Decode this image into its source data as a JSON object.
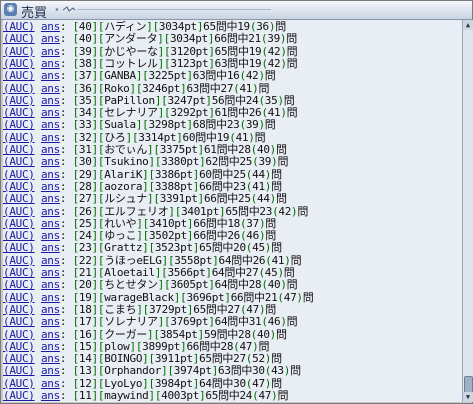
{
  "window": {
    "title": "売買"
  },
  "prefix": "(AUC)",
  "ans": "ans",
  "colon": ":",
  "rows": [
    {
      "rank": "40",
      "name": "ハディン",
      "pts": "3034pt",
      "pct": "65",
      "word": "問中",
      "a": "19",
      "b": "36",
      "tail": "問"
    },
    {
      "rank": "40",
      "name": "アンダータ",
      "pts": "3034pt",
      "pct": "66",
      "word": "問中",
      "a": "21",
      "b": "39",
      "tail": "問"
    },
    {
      "rank": "39",
      "name": "かじやーな",
      "pts": "3120pt",
      "pct": "65",
      "word": "問中",
      "a": "19",
      "b": "42",
      "tail": "問"
    },
    {
      "rank": "38",
      "name": "コットレル",
      "pts": "3123pt",
      "pct": "63",
      "word": "問中",
      "a": "19",
      "b": "42",
      "tail": "問"
    },
    {
      "rank": "37",
      "name": "GANBA",
      "pts": "3225pt",
      "pct": "63",
      "word": "問中",
      "a": "16",
      "b": "42",
      "tail": "問"
    },
    {
      "rank": "36",
      "name": "Roko",
      "pts": "3246pt",
      "pct": "63",
      "word": "問中",
      "a": "27",
      "b": "41",
      "tail": "問"
    },
    {
      "rank": "35",
      "name": "PaPillon",
      "pts": "3247pt",
      "pct": "56",
      "word": "問中",
      "a": "24",
      "b": "35",
      "tail": "問"
    },
    {
      "rank": "34",
      "name": "セレナリア",
      "pts": "3292pt",
      "pct": "61",
      "word": "問中",
      "a": "26",
      "b": "41",
      "tail": "問"
    },
    {
      "rank": "33",
      "name": "Suala",
      "pts": "3298pt",
      "pct": "68",
      "word": "問中",
      "a": "23",
      "b": "39",
      "tail": "問"
    },
    {
      "rank": "32",
      "name": "ひろ",
      "pts": "3314pt",
      "pct": "60",
      "word": "問中",
      "a": "19",
      "b": "41",
      "tail": "問"
    },
    {
      "rank": "31",
      "name": "おでぃん",
      "pts": "3375pt",
      "pct": "61",
      "word": "問中",
      "a": "28",
      "b": "40",
      "tail": "問"
    },
    {
      "rank": "30",
      "name": "Tsukino",
      "pts": "3380pt",
      "pct": "62",
      "word": "問中",
      "a": "25",
      "b": "39",
      "tail": "問"
    },
    {
      "rank": "29",
      "name": "AlariK",
      "pts": "3386pt",
      "pct": "60",
      "word": "問中",
      "a": "25",
      "b": "44",
      "tail": "問"
    },
    {
      "rank": "28",
      "name": "aozora",
      "pts": "3388pt",
      "pct": "66",
      "word": "問中",
      "a": "23",
      "b": "41",
      "tail": "問"
    },
    {
      "rank": "27",
      "name": "ルシュナ",
      "pts": "3391pt",
      "pct": "66",
      "word": "問中",
      "a": "25",
      "b": "44",
      "tail": "問"
    },
    {
      "rank": "26",
      "name": "エルフェリオ",
      "pts": "3401pt",
      "pct": "65",
      "word": "問中",
      "a": "23",
      "b": "42",
      "tail": "問"
    },
    {
      "rank": "25",
      "name": "れいや",
      "pts": "3410pt",
      "pct": "66",
      "word": "問中",
      "a": "18",
      "b": "37",
      "tail": "問"
    },
    {
      "rank": "24",
      "name": "ゆっこ",
      "pts": "3502pt",
      "pct": "66",
      "word": "問中",
      "a": "26",
      "b": "46",
      "tail": "問"
    },
    {
      "rank": "23",
      "name": "Grattz",
      "pts": "3523pt",
      "pct": "65",
      "word": "問中",
      "a": "20",
      "b": "45",
      "tail": "問"
    },
    {
      "rank": "22",
      "name": "うほっeELG",
      "pts": "3558pt",
      "pct": "64",
      "word": "問中",
      "a": "26",
      "b": "41",
      "tail": "問"
    },
    {
      "rank": "21",
      "name": "Aloetail",
      "pts": "3566pt",
      "pct": "64",
      "word": "問中",
      "a": "27",
      "b": "45",
      "tail": "問"
    },
    {
      "rank": "20",
      "name": "ちとせタン",
      "pts": "3605pt",
      "pct": "64",
      "word": "問中",
      "a": "28",
      "b": "40",
      "tail": "問"
    },
    {
      "rank": "19",
      "name": "warageBlack",
      "pts": "3696pt",
      "pct": "66",
      "word": "問中",
      "a": "21",
      "b": "47",
      "tail": "問"
    },
    {
      "rank": "18",
      "name": "こまち",
      "pts": "3729pt",
      "pct": "65",
      "word": "問中",
      "a": "27",
      "b": "47",
      "tail": "問"
    },
    {
      "rank": "17",
      "name": "ソレナリア",
      "pts": "3769pt",
      "pct": "64",
      "word": "問中",
      "a": "31",
      "b": "46",
      "tail": "問"
    },
    {
      "rank": "16",
      "name": "クーガー",
      "pts": "3854pt",
      "pct": "59",
      "word": "問中",
      "a": "28",
      "b": "40",
      "tail": "問"
    },
    {
      "rank": "15",
      "name": "plow",
      "pts": "3899pt",
      "pct": "66",
      "word": "問中",
      "a": "28",
      "b": "47",
      "tail": "問"
    },
    {
      "rank": "14",
      "name": "BOINGO",
      "pts": "3911pt",
      "pct": "65",
      "word": "問中",
      "a": "27",
      "b": "52",
      "tail": "問"
    },
    {
      "rank": "13",
      "name": "Orphandor",
      "pts": "3974pt",
      "pct": "63",
      "word": "問中",
      "a": "30",
      "b": "43",
      "tail": "問"
    },
    {
      "rank": "12",
      "name": "LyoLyo",
      "pts": "3984pt",
      "pct": "64",
      "word": "問中",
      "a": "30",
      "b": "47",
      "tail": "問"
    },
    {
      "rank": "11",
      "name": "maywind",
      "pts": "4003pt",
      "pct": "65",
      "word": "問中",
      "a": "24",
      "b": "47",
      "tail": "問"
    }
  ]
}
